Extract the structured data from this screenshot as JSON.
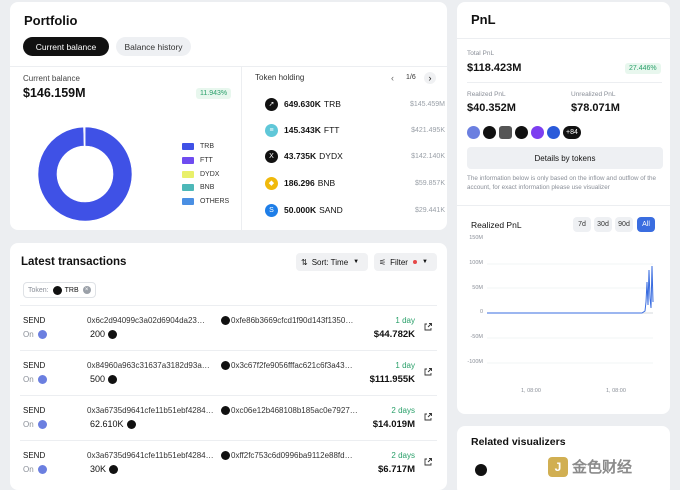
{
  "portfolio": {
    "title": "Portfolio",
    "tabs": [
      "Current balance",
      "Balance history"
    ],
    "current_balance_label": "Current balance",
    "current_balance": "$146.159M",
    "change_badge": "11.943%",
    "legend": [
      "TRB",
      "FTT",
      "DYDX",
      "BNB",
      "OTHERS"
    ],
    "legend_colors": [
      "#3f51e6",
      "#6f4cf0",
      "#e9f06a",
      "#4db8b8",
      "#4a8fe3"
    ],
    "token_holding_label": "Token holding",
    "pager": "1/6",
    "tokens": [
      {
        "amount": "649.630K",
        "symbol": "TRB",
        "value": "$145.459M",
        "icon": "trb-icon",
        "color": "#111111",
        "glyph": "➚"
      },
      {
        "amount": "145.343K",
        "symbol": "FTT",
        "value": "$421.495K",
        "icon": "ftt-icon",
        "color": "#5fc7d8",
        "glyph": "≡"
      },
      {
        "amount": "43.735K",
        "symbol": "DYDX",
        "value": "$142.140K",
        "icon": "dydx-icon",
        "color": "#111111",
        "glyph": "X"
      },
      {
        "amount": "186.296",
        "symbol": "BNB",
        "value": "$59.857K",
        "icon": "bnb-icon",
        "color": "#f0b90b",
        "glyph": "◆"
      },
      {
        "amount": "50.000K",
        "symbol": "SAND",
        "value": "$29.441K",
        "icon": "sand-icon",
        "color": "#1e7ee8",
        "glyph": "S"
      }
    ]
  },
  "chart_data": {
    "type": "pie",
    "title": "",
    "categories": [
      "TRB",
      "FTT",
      "DYDX",
      "BNB",
      "OTHERS"
    ],
    "values": [
      145.459,
      0.421,
      0.142,
      0.06,
      0.077
    ]
  },
  "transactions": {
    "title": "Latest transactions",
    "sort_label": "Sort: Time",
    "filter_label": "Filter",
    "chip_prefix": "Token:",
    "chip_token": "TRB",
    "rows": [
      {
        "type": "SEND",
        "on": "On",
        "from": "0x6c2d94099c3a02d6904da23…",
        "to": "0xfe86b3669cfcd1f90d143f1350…",
        "amount": "200",
        "time": "1 day",
        "usd": "$44.782K"
      },
      {
        "type": "SEND",
        "on": "On",
        "from": "0x84960a963c31637a3182d93a…",
        "to": "0x3c67f2fe9056fffac621c6f3a43…",
        "amount": "500",
        "time": "1 day",
        "usd": "$111.955K"
      },
      {
        "type": "SEND",
        "on": "On",
        "from": "0x3a6735d9641cfe11b51ebf4284…",
        "to": "0xc06e12b468108b185ac0e7927…",
        "amount": "62.610K",
        "time": "2 days",
        "usd": "$14.019M"
      },
      {
        "type": "SEND",
        "on": "On",
        "from": "0x3a6735d9641cfe11b51ebf4284…",
        "to": "0xff2fc753c6d0996ba9112e88fd…",
        "amount": "30K",
        "time": "2 days",
        "usd": "$6.717M"
      }
    ]
  },
  "pnl": {
    "title": "PnL",
    "total_label": "Total PnL",
    "total_value": "$118.423M",
    "total_badge": "27.446%",
    "realized_label": "Realized PnL",
    "realized_value": "$40.352M",
    "unrealized_label": "Unrealized PnL",
    "unrealized_value": "$78.071M",
    "more_count": "+84",
    "details_button": "Details by tokens",
    "note": "The information below is only based on the inflow and outflow of the account, for exact information please use visualizer",
    "chart_title": "Realized PnL",
    "ranges": [
      "7d",
      "30d",
      "90d",
      "All"
    ],
    "y_ticks": [
      "150M",
      "100M",
      "50M",
      "0",
      "-50M",
      "-100M"
    ],
    "x_ticks": [
      "1, 08:00",
      "1, 08:00"
    ]
  },
  "related": {
    "title": "Related visualizers"
  },
  "watermark": "金色财经"
}
